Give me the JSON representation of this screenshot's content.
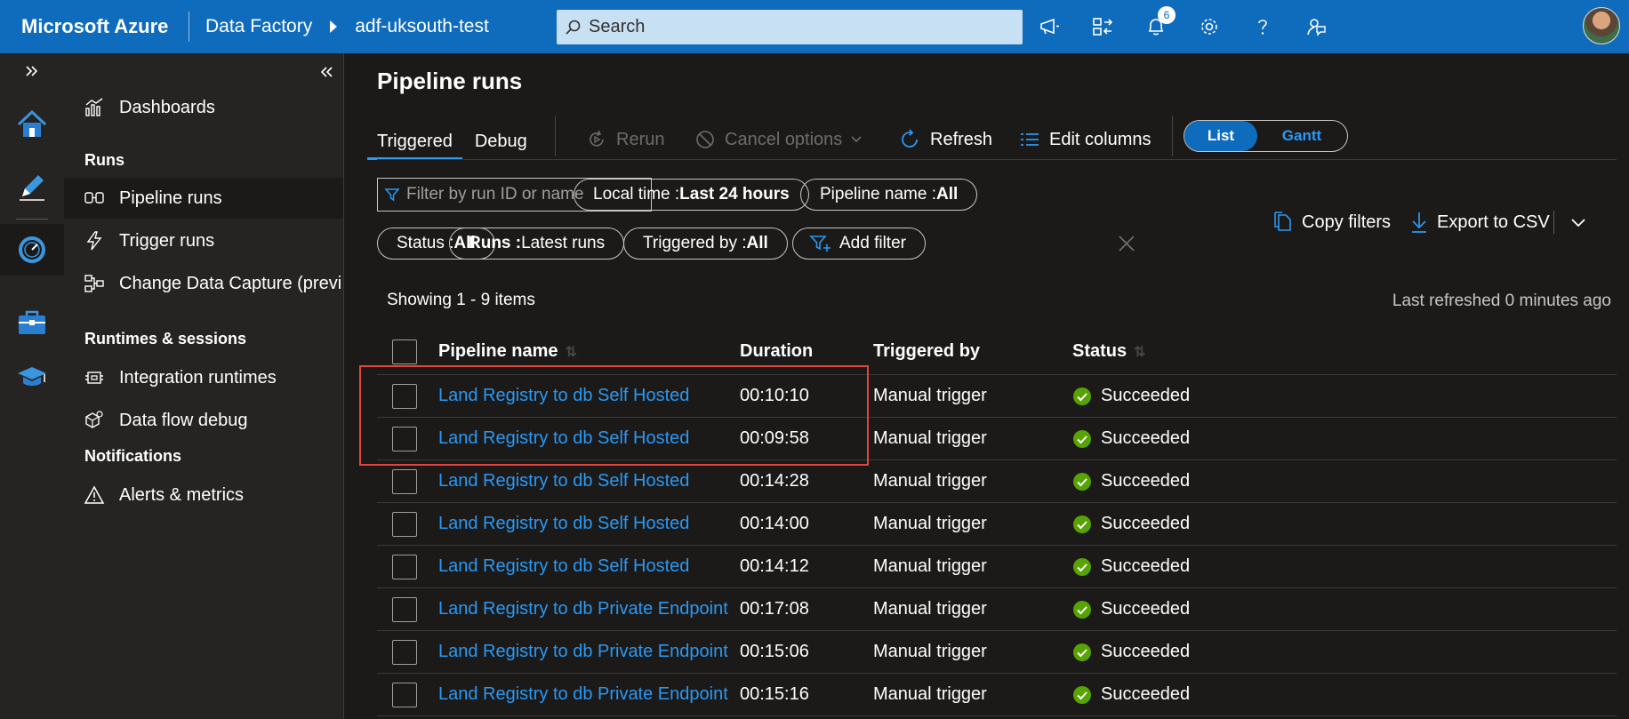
{
  "topbar": {
    "brand": "Microsoft Azure",
    "breadcrumb": [
      "Data Factory",
      "adf-uksouth-test"
    ],
    "search_placeholder": "Search",
    "notification_count": "6",
    "colors": {
      "bar": "#0f6cbd"
    }
  },
  "nav": {
    "items": {
      "dashboards": "Dashboards",
      "pipeline_runs": "Pipeline runs",
      "trigger_runs": "Trigger runs",
      "cdc": "Change Data Capture (previ...",
      "integration_runtimes": "Integration runtimes",
      "dataflow_debug": "Data flow debug",
      "alerts": "Alerts & metrics"
    },
    "headings": {
      "runs": "Runs",
      "runtimes": "Runtimes & sessions",
      "notifications": "Notifications"
    }
  },
  "main": {
    "title": "Pipeline runs",
    "tabs": [
      "Triggered",
      "Debug"
    ],
    "commands": {
      "rerun": "Rerun",
      "cancel": "Cancel options",
      "refresh": "Refresh",
      "edit_columns": "Edit columns"
    },
    "view_toggle": {
      "list": "List",
      "gantt": "Gantt"
    },
    "filter_placeholder": "Filter by run ID or name",
    "pills": {
      "time": {
        "label": "Local time : ",
        "value": "Last 24 hours"
      },
      "pipeline_name": {
        "label": "Pipeline name : ",
        "value": "All"
      },
      "status": {
        "label": "Status : ",
        "value": "All"
      },
      "runs": {
        "label": "Runs : ",
        "value": "Latest runs"
      },
      "triggered_by": {
        "label": "Triggered by : ",
        "value": "All"
      },
      "add_filter": "Add filter"
    },
    "copy_filters": "Copy filters",
    "export_csv": "Export to CSV",
    "showing": "Showing 1 - 9 items",
    "last_refreshed": "Last refreshed 0 minutes ago"
  },
  "table": {
    "headers": {
      "name": "Pipeline name",
      "duration": "Duration",
      "triggered_by": "Triggered by",
      "status": "Status"
    },
    "rows": [
      {
        "name": "Land Registry to db Self Hosted",
        "duration": "00:10:10",
        "trigger": "Manual trigger",
        "status": "Succeeded"
      },
      {
        "name": "Land Registry to db Self Hosted",
        "duration": "00:09:58",
        "trigger": "Manual trigger",
        "status": "Succeeded"
      },
      {
        "name": "Land Registry to db Self Hosted",
        "duration": "00:14:28",
        "trigger": "Manual trigger",
        "status": "Succeeded"
      },
      {
        "name": "Land Registry to db Self Hosted",
        "duration": "00:14:00",
        "trigger": "Manual trigger",
        "status": "Succeeded"
      },
      {
        "name": "Land Registry to db Self Hosted",
        "duration": "00:14:12",
        "trigger": "Manual trigger",
        "status": "Succeeded"
      },
      {
        "name": "Land Registry to db Private Endpoint",
        "duration": "00:17:08",
        "trigger": "Manual trigger",
        "status": "Succeeded"
      },
      {
        "name": "Land Registry to db Private Endpoint",
        "duration": "00:15:06",
        "trigger": "Manual trigger",
        "status": "Succeeded"
      },
      {
        "name": "Land Registry to db Private Endpoint",
        "duration": "00:15:16",
        "trigger": "Manual trigger",
        "status": "Succeeded"
      }
    ]
  },
  "colors": {
    "link": "#2899f5",
    "success": "#57a300",
    "highlight_box": "#e0463e"
  }
}
